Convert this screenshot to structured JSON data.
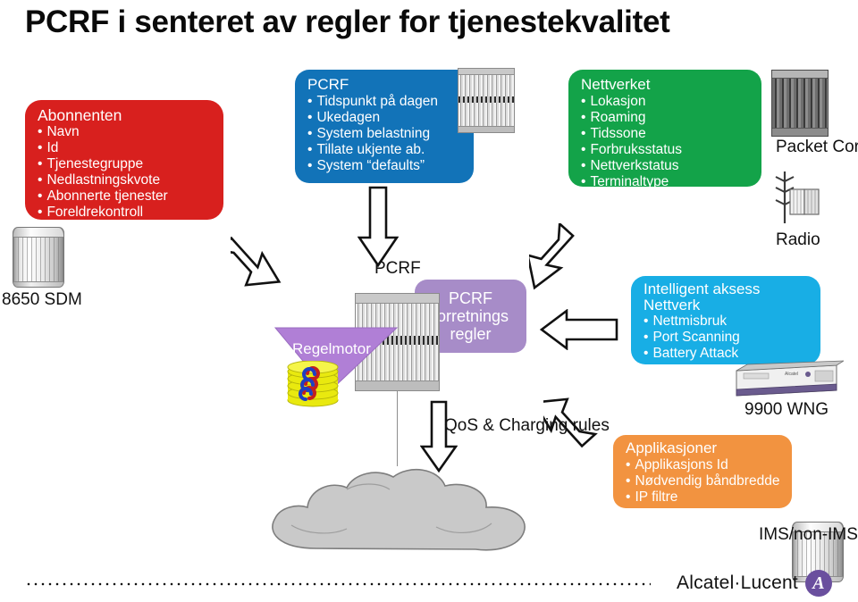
{
  "title": "PCRF i senteret av regler for tjenestekvalitet",
  "boxes": {
    "abonnent": {
      "title": "Abonnenten",
      "color": "#d8201e",
      "items": [
        "Navn",
        "Id",
        "Tjenestegruppe",
        "Nedlastningskvote",
        "Abonnerte tjenester",
        "Foreldrekontroll"
      ]
    },
    "pcrf_top": {
      "title": "PCRF",
      "color": "#1273b8",
      "items": [
        "Tidspunkt på dagen",
        "Ukedagen",
        "System belastning",
        "Tillate ukjente ab.",
        "System “defaults”"
      ]
    },
    "nettverket": {
      "title": "Nettverket",
      "color": "#13a349",
      "items": [
        "Lokasjon",
        "Roaming",
        "Tidssone",
        "Forbruksstatus",
        "Nettverkstatus",
        "Terminaltype"
      ]
    },
    "intelligent": {
      "title": "Intelligent aksess Nettverk",
      "color": "#18aee5",
      "items": [
        "Nettmisbruk",
        "Port Scanning",
        "Battery Attack"
      ]
    },
    "applikasjoner": {
      "title": "Applikasjoner",
      "color": "#f29340",
      "items": [
        "Applikasjons Id",
        "Nødvendig båndbredde",
        "IP filtre"
      ]
    },
    "pcrf_rules": {
      "text": "PCRF forretnings regler",
      "color": "#a78cc8"
    }
  },
  "labels": {
    "packet_core": "Packet Core",
    "radio": "Radio",
    "sdm": "8650 SDM",
    "pcrf_mid": "PCRF",
    "wng": "9900 WNG",
    "ims": "IMS/non-IMS",
    "qos": "QoS & Charging rules",
    "regelmotor": "Regelmotor"
  },
  "footer": {
    "brand": "Alcatel·Lucent",
    "mark": "A"
  }
}
